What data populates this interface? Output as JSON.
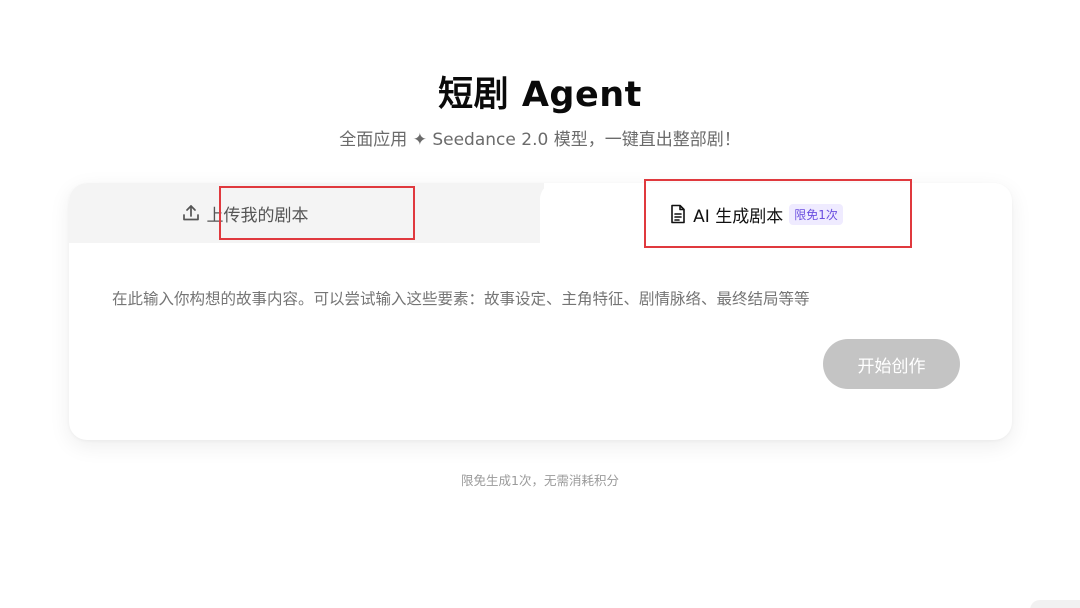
{
  "header": {
    "title": "短剧 Agent",
    "subtitle": "全面应用 ✦ Seedance 2.0 模型，一键直出整部剧！"
  },
  "tabs": {
    "upload": {
      "label": "上传我的剧本",
      "icon": "upload-icon"
    },
    "ai": {
      "label": "AI 生成剧本",
      "icon": "document-icon",
      "badge": "限免1次"
    }
  },
  "editor": {
    "placeholder": "在此输入你构想的故事内容。可以尝试输入这些要素：故事设定、主角特征、剧情脉络、最终结局等等",
    "value": ""
  },
  "actions": {
    "start_label": "开始创作"
  },
  "footer": {
    "note": "限免生成1次，无需消耗积分"
  },
  "colors": {
    "highlight_border": "#e0393e",
    "badge_text": "#6b4fe0",
    "badge_bg": "#efebff",
    "button_disabled": "#c4c4c4"
  }
}
